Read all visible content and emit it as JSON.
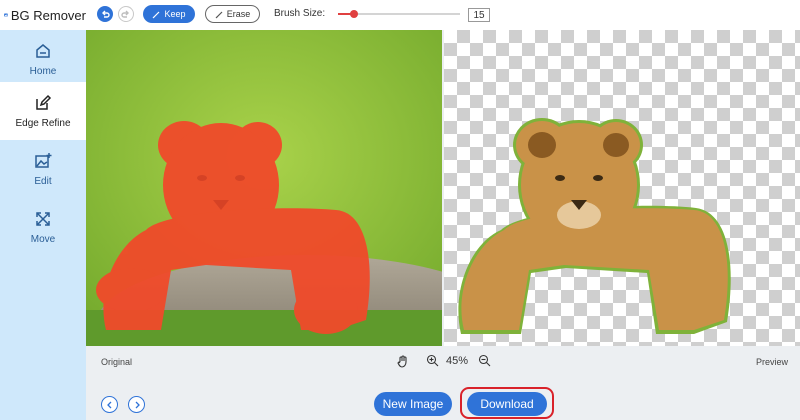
{
  "app": {
    "title": "BG Remover"
  },
  "sidebar": {
    "items": [
      {
        "label": "Home",
        "icon": "home-icon"
      },
      {
        "label": "Edge Refine",
        "icon": "edit-square-icon",
        "active": true
      },
      {
        "label": "Edit",
        "icon": "image-edit-icon"
      },
      {
        "label": "Move",
        "icon": "move-arrows-icon"
      }
    ]
  },
  "toolbar": {
    "keep_label": "Keep",
    "erase_label": "Erase",
    "brush_label": "Brush Size:",
    "brush_value": "15",
    "brush_fraction": 0.13
  },
  "status": {
    "original_label": "Original",
    "preview_label": "Preview",
    "zoom": "45%"
  },
  "bottom": {
    "new_image_label": "New Image",
    "download_label": "Download"
  },
  "colors": {
    "accent": "#2f73d8",
    "sidebar_bg": "#cfe8fb",
    "highlight": "#d9222a",
    "mask": "#f04a2a"
  }
}
